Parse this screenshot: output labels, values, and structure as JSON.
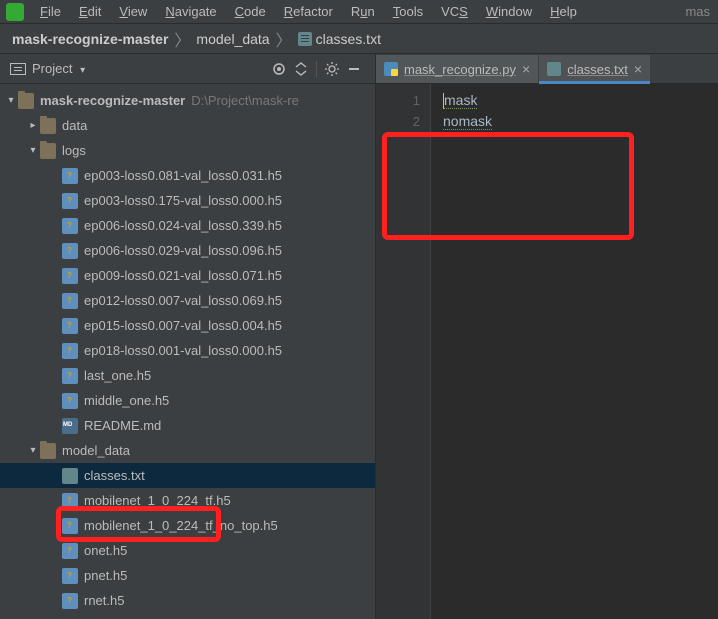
{
  "menubar": {
    "items": [
      "File",
      "Edit",
      "View",
      "Navigate",
      "Code",
      "Refactor",
      "Run",
      "Tools",
      "VCS",
      "Window",
      "Help"
    ],
    "right": "mas"
  },
  "breadcrumb": {
    "root": "mask-recognize-master",
    "mid": "model_data",
    "leaf": "classes.txt"
  },
  "projectPanel": {
    "label": "Project"
  },
  "tree": {
    "rootName": "mask-recognize-master",
    "rootPath": "D:\\Project\\mask-re",
    "children": [
      {
        "name": "data",
        "kind": "folder",
        "expanded": false,
        "indent": 1
      },
      {
        "name": "logs",
        "kind": "folder",
        "expanded": true,
        "indent": 1
      },
      {
        "name": "ep003-loss0.081-val_loss0.031.h5",
        "kind": "h5",
        "indent": 2
      },
      {
        "name": "ep003-loss0.175-val_loss0.000.h5",
        "kind": "h5",
        "indent": 2
      },
      {
        "name": "ep006-loss0.024-val_loss0.339.h5",
        "kind": "h5",
        "indent": 2
      },
      {
        "name": "ep006-loss0.029-val_loss0.096.h5",
        "kind": "h5",
        "indent": 2
      },
      {
        "name": "ep009-loss0.021-val_loss0.071.h5",
        "kind": "h5",
        "indent": 2
      },
      {
        "name": "ep012-loss0.007-val_loss0.069.h5",
        "kind": "h5",
        "indent": 2
      },
      {
        "name": "ep015-loss0.007-val_loss0.004.h5",
        "kind": "h5",
        "indent": 2
      },
      {
        "name": "ep018-loss0.001-val_loss0.000.h5",
        "kind": "h5",
        "indent": 2
      },
      {
        "name": "last_one.h5",
        "kind": "h5",
        "indent": 2
      },
      {
        "name": "middle_one.h5",
        "kind": "h5",
        "indent": 2
      },
      {
        "name": "README.md",
        "kind": "md",
        "indent": 2
      },
      {
        "name": "model_data",
        "kind": "folder",
        "expanded": true,
        "indent": 1
      },
      {
        "name": "classes.txt",
        "kind": "txt",
        "indent": 2,
        "selected": true
      },
      {
        "name": "mobilenet_1_0_224_tf.h5",
        "kind": "h5",
        "indent": 2
      },
      {
        "name": "mobilenet_1_0_224_tf_no_top.h5",
        "kind": "h5",
        "indent": 2
      },
      {
        "name": "onet.h5",
        "kind": "h5",
        "indent": 2
      },
      {
        "name": "pnet.h5",
        "kind": "h5",
        "indent": 2
      },
      {
        "name": "rnet.h5",
        "kind": "h5",
        "indent": 2
      }
    ]
  },
  "tabs": [
    {
      "title": "mask_recognize.py",
      "icon": "py",
      "active": false
    },
    {
      "title": "classes.txt",
      "icon": "txt",
      "active": true
    }
  ],
  "editor": {
    "lineNumbers": [
      "1",
      "2"
    ],
    "lines": [
      "mask",
      "nomask"
    ]
  }
}
